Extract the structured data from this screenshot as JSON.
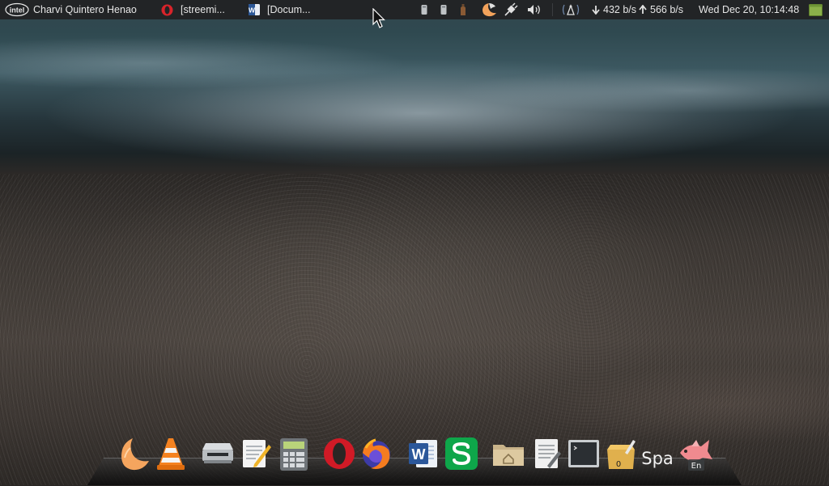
{
  "panel": {
    "menu_logo_text": "intel",
    "user_name": "Charvi Quintero Henao",
    "tasks": [
      {
        "title": "[streemi...",
        "icon": "opera-icon"
      },
      {
        "title": "[Docum...",
        "icon": "word-icon"
      }
    ],
    "net_down": "432 b/s",
    "net_up": "566 b/s",
    "clock": "Wed Dec 20, 10:14:48"
  },
  "dock": {
    "apps": [
      "clementine-icon",
      "vlc-icon",
      "scanner-icon",
      "text-editor-icon",
      "calculator-icon",
      "opera-icon",
      "firefox-icon",
      "word-icon",
      "spreadsheet-icon",
      "file-manager-icon",
      "document-icon",
      "terminal-icon",
      "archive-icon",
      "spa-text",
      "fish-icon"
    ],
    "spa_label": "Spa",
    "archive_badge": "0",
    "fish_badge": "En"
  }
}
